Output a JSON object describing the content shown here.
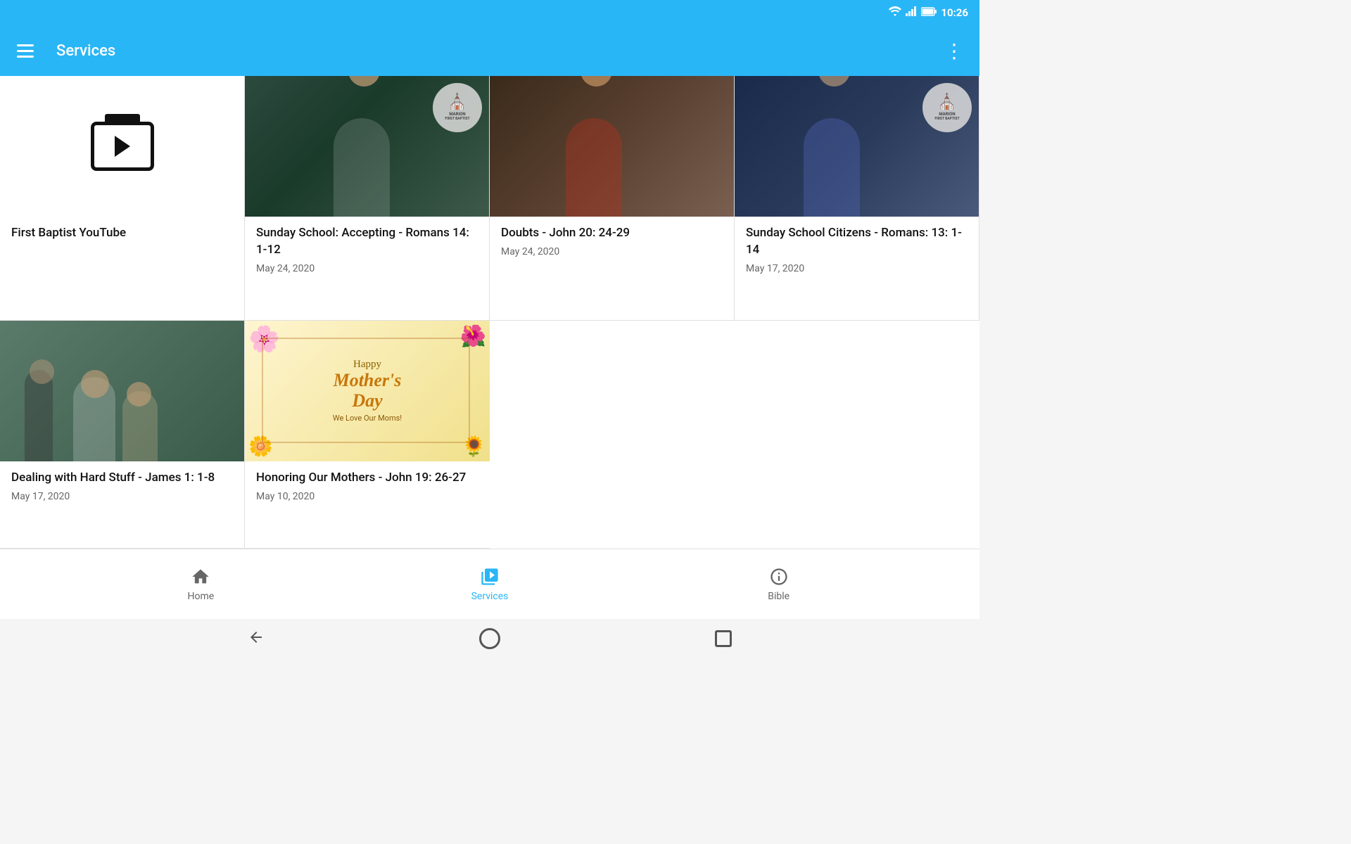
{
  "statusBar": {
    "time": "10:26",
    "wifiIcon": "wifi",
    "signalIcon": "signal",
    "batteryIcon": "battery"
  },
  "appBar": {
    "menuIcon": "menu",
    "title": "Services",
    "moreIcon": "more-vert"
  },
  "videos": [
    {
      "id": "youtube-channel",
      "type": "channel",
      "title": "First Baptist YouTube",
      "date": "",
      "thumb": "placeholder"
    },
    {
      "id": "sunday-school-accepting",
      "type": "video",
      "title": "Sunday School: Accepting - Romans 14: 1-12",
      "date": "May 24, 2020",
      "thumb": "person-dark",
      "hasBadge": true
    },
    {
      "id": "doubts-john",
      "type": "video",
      "title": "Doubts - John 20: 24-29",
      "date": "May 24, 2020",
      "thumb": "person-red",
      "hasBadge": false
    },
    {
      "id": "sunday-school-citizens",
      "type": "video",
      "title": "Sunday School Citizens - Romans: 13: 1-14",
      "date": "May 17, 2020",
      "thumb": "person-blue",
      "hasBadge": true
    },
    {
      "id": "dealing-hard-stuff",
      "type": "video",
      "title": "Dealing with Hard Stuff - James 1: 1-8",
      "date": "May 17, 2020",
      "thumb": "person-band"
    },
    {
      "id": "honoring-mothers",
      "type": "video",
      "title": "Honoring Our Mothers - John 19: 26-27",
      "date": "May 10, 2020",
      "thumb": "mothers-day"
    }
  ],
  "bottomNav": {
    "items": [
      {
        "id": "home",
        "label": "Home",
        "icon": "🏠",
        "active": false
      },
      {
        "id": "services",
        "label": "Services",
        "icon": "▶",
        "active": true
      },
      {
        "id": "bible",
        "label": "Bible",
        "icon": "✝",
        "active": false
      }
    ]
  },
  "sysNav": {
    "back": "◀",
    "home": "circle",
    "recents": "square"
  },
  "marionBadge": {
    "line1": "MARION",
    "line2": "FIRST BAPTIST"
  }
}
